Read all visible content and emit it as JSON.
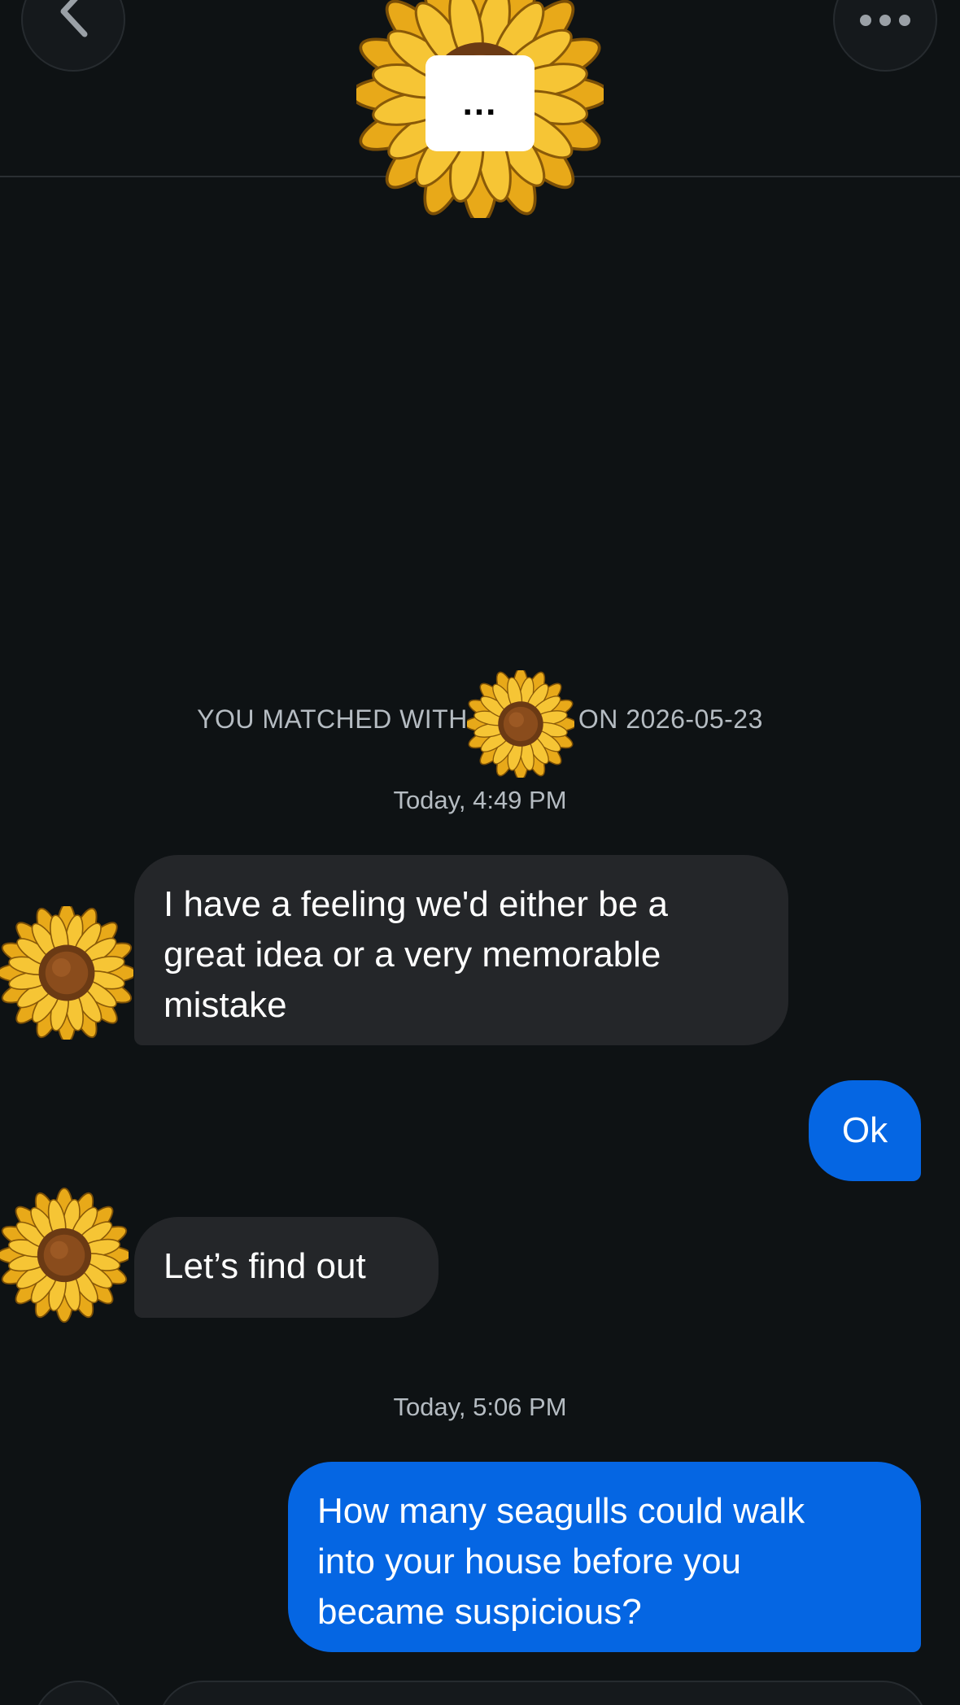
{
  "header": {
    "back_icon": "chevron-left-icon",
    "more_icon": "more-horizontal-icon",
    "typing_indicator": "..."
  },
  "chat": {
    "match_notice": {
      "prefix": "YOU MATCHED WITH",
      "suffix": "ON 2026-05-23"
    },
    "groups": [
      {
        "timestamp": "Today, 4:49 PM",
        "messages": [
          {
            "sender": "them",
            "text": "I have a feeling we'd either be a\ngreat idea or a very memorable\nmistake"
          },
          {
            "sender": "me",
            "text": "Ok"
          },
          {
            "sender": "them",
            "text": "Let’s find out"
          }
        ]
      },
      {
        "timestamp": "Today, 5:06 PM",
        "messages": [
          {
            "sender": "me",
            "text": "How many seagulls could walk\ninto your house before you\nbecame suspicious?"
          }
        ]
      }
    ]
  },
  "colors": {
    "background": "#0e1214",
    "incoming_bubble": "#242629",
    "outgoing_bubble": "#0566e3",
    "meta_text": "#b5bcc2"
  }
}
